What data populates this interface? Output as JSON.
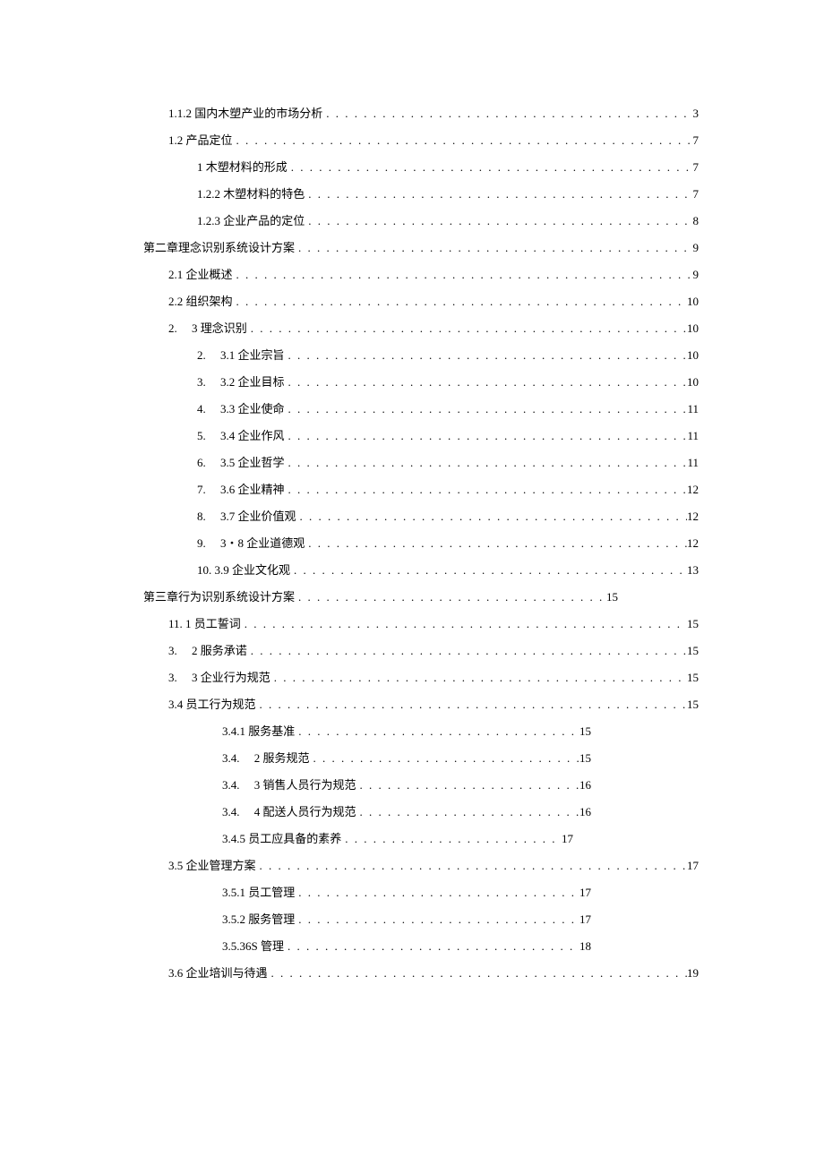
{
  "toc": {
    "entries": [
      {
        "indent": "ind1",
        "label": "1.1.2 国内木塑产业的市场分析",
        "page": "3",
        "width": ""
      },
      {
        "indent": "ind1",
        "label": "1.2 产品定位",
        "page": "7",
        "width": ""
      },
      {
        "indent": "ind2",
        "label": "1 木塑材料的形成",
        "page": "7",
        "width": ""
      },
      {
        "indent": "ind2",
        "label": "1.2.2 木塑材料的特色",
        "page": "7",
        "width": ""
      },
      {
        "indent": "ind2",
        "label": "1.2.3 企业产品的定位",
        "page": "8",
        "width": ""
      },
      {
        "indent": "ind0",
        "label": "第二章理念识别系统设计方案",
        "page": "9",
        "width": ""
      },
      {
        "indent": "ind1",
        "label": "2.1 企业概述",
        "page": "9",
        "width": ""
      },
      {
        "indent": "ind1",
        "label": "2.2 组织架构",
        "page": "10",
        "width": ""
      },
      {
        "indent": "ind1",
        "label": "2.  3 理念识别",
        "page": "10",
        "width": ""
      },
      {
        "indent": "ind2",
        "label": "2.  3.1 企业宗旨",
        "page": "10",
        "width": ""
      },
      {
        "indent": "ind2",
        "label": "3.  3.2 企业目标",
        "page": "10",
        "width": ""
      },
      {
        "indent": "ind2",
        "label": "4.  3.3 企业使命",
        "page": "11",
        "width": ""
      },
      {
        "indent": "ind2",
        "label": "5.  3.4 企业作风",
        "page": "11",
        "width": ""
      },
      {
        "indent": "ind2",
        "label": "6.  3.5 企业哲学",
        "page": "11",
        "width": ""
      },
      {
        "indent": "ind2",
        "label": "7.  3.6 企业精神",
        "page": "12",
        "width": ""
      },
      {
        "indent": "ind2",
        "label": "8.  3.7 企业价值观",
        "page": "12",
        "width": ""
      },
      {
        "indent": "ind2",
        "label": "9.  3・8 企业道德观",
        "page": "12",
        "width": ""
      },
      {
        "indent": "ind2",
        "label": "10. 3.9 企业文化观",
        "page": "13",
        "width": ""
      },
      {
        "indent": "ind0",
        "label": "第三章行为识别系统设计方案",
        "page": "15",
        "width": "short1"
      },
      {
        "indent": "ind1",
        "label": "11. 1 员工誓词",
        "page": "15",
        "width": ""
      },
      {
        "indent": "ind1",
        "label": "3.  2 服务承诺",
        "page": "15",
        "width": ""
      },
      {
        "indent": "ind1",
        "label": "3.  3 企业行为规范",
        "page": "15",
        "width": ""
      },
      {
        "indent": "ind1",
        "label": "3.4 员工行为规范",
        "page": "15",
        "width": ""
      },
      {
        "indent": "ind3",
        "label": "3.4.1 服务基准",
        "page": "15",
        "width": "short2"
      },
      {
        "indent": "ind3",
        "label": "3.4.  2 服务规范",
        "page": "15",
        "width": "short2"
      },
      {
        "indent": "ind3",
        "label": "3.4.  3 销售人员行为规范",
        "page": "16",
        "width": "short2"
      },
      {
        "indent": "ind3",
        "label": "3.4.  4 配送人员行为规范",
        "page": "16",
        "width": "short2"
      },
      {
        "indent": "ind3",
        "label": "3.4.5 员工应具备的素养",
        "page": "17",
        "width": "short3"
      },
      {
        "indent": "ind1",
        "label": "3.5 企业管理方案",
        "page": "17",
        "width": ""
      },
      {
        "indent": "ind3",
        "label": "3.5.1 员工管理",
        "page": "17",
        "width": "short2"
      },
      {
        "indent": "ind3",
        "label": "3.5.2 服务管理",
        "page": "17",
        "width": "short2"
      },
      {
        "indent": "ind3",
        "label": "3.5.36S 管理",
        "page": "18",
        "width": "short2"
      },
      {
        "indent": "ind1",
        "label": "3.6 企业培训与待遇",
        "page": "19",
        "width": ""
      }
    ]
  }
}
